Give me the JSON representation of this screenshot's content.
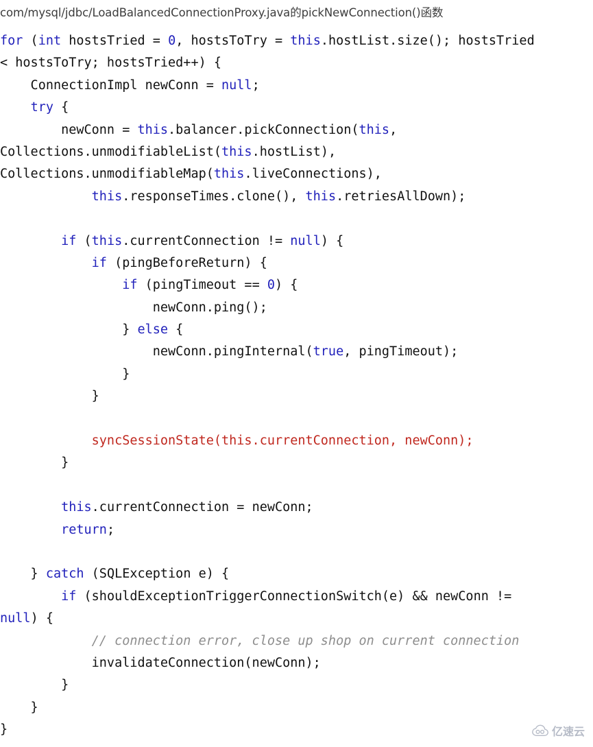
{
  "caption": {
    "text": "com/mysql/jdbc/LoadBalancedConnectionProxy.java的pickNewConnection()函数"
  },
  "colors": {
    "background": "#ffffff",
    "plain_text": "#111111",
    "keyword": "#2222bb",
    "highlight": "#c0281f",
    "comment": "#8d8d8d",
    "caption": "#3d3d3d",
    "watermark": "#8a93a5"
  },
  "code": {
    "language": "java",
    "lines": [
      {
        "n": 1,
        "segments": [
          {
            "t": "for",
            "c": "kw"
          },
          {
            "t": " (",
            "c": "pl"
          },
          {
            "t": "int",
            "c": "kw"
          },
          {
            "t": " hostsTried = ",
            "c": "pl"
          },
          {
            "t": "0",
            "c": "kw"
          },
          {
            "t": ", hostsToTry = ",
            "c": "pl"
          },
          {
            "t": "this",
            "c": "kw"
          },
          {
            "t": ".hostList.size(); hostsTried",
            "c": "pl"
          }
        ]
      },
      {
        "n": 2,
        "segments": [
          {
            "t": "< hostsToTry; hostsTried++) {",
            "c": "pl"
          }
        ]
      },
      {
        "n": 3,
        "segments": [
          {
            "t": "    ConnectionImpl newConn = ",
            "c": "pl"
          },
          {
            "t": "null",
            "c": "kw"
          },
          {
            "t": ";",
            "c": "pl"
          }
        ]
      },
      {
        "n": 4,
        "segments": [
          {
            "t": "    ",
            "c": "pl"
          },
          {
            "t": "try",
            "c": "kw"
          },
          {
            "t": " {",
            "c": "pl"
          }
        ]
      },
      {
        "n": 5,
        "segments": [
          {
            "t": "        newConn = ",
            "c": "pl"
          },
          {
            "t": "this",
            "c": "kw"
          },
          {
            "t": ".balancer.pickConnection(",
            "c": "pl"
          },
          {
            "t": "this",
            "c": "kw"
          },
          {
            "t": ",",
            "c": "pl"
          }
        ]
      },
      {
        "n": 6,
        "segments": [
          {
            "t": "Collections.unmodifiableList(",
            "c": "pl"
          },
          {
            "t": "this",
            "c": "kw"
          },
          {
            "t": ".hostList),",
            "c": "pl"
          }
        ]
      },
      {
        "n": 7,
        "segments": [
          {
            "t": "Collections.unmodifiableMap(",
            "c": "pl"
          },
          {
            "t": "this",
            "c": "kw"
          },
          {
            "t": ".liveConnections),",
            "c": "pl"
          }
        ]
      },
      {
        "n": 8,
        "segments": [
          {
            "t": "            ",
            "c": "pl"
          },
          {
            "t": "this",
            "c": "kw"
          },
          {
            "t": ".responseTimes.clone(), ",
            "c": "pl"
          },
          {
            "t": "this",
            "c": "kw"
          },
          {
            "t": ".retriesAllDown);",
            "c": "pl"
          }
        ]
      },
      {
        "n": 9,
        "segments": [
          {
            "t": "",
            "c": "pl"
          }
        ]
      },
      {
        "n": 10,
        "segments": [
          {
            "t": "        ",
            "c": "pl"
          },
          {
            "t": "if",
            "c": "kw"
          },
          {
            "t": " (",
            "c": "pl"
          },
          {
            "t": "this",
            "c": "kw"
          },
          {
            "t": ".currentConnection != ",
            "c": "pl"
          },
          {
            "t": "null",
            "c": "kw"
          },
          {
            "t": ") {",
            "c": "pl"
          }
        ]
      },
      {
        "n": 11,
        "segments": [
          {
            "t": "            ",
            "c": "pl"
          },
          {
            "t": "if",
            "c": "kw"
          },
          {
            "t": " (pingBeforeReturn) {",
            "c": "pl"
          }
        ]
      },
      {
        "n": 12,
        "segments": [
          {
            "t": "                ",
            "c": "pl"
          },
          {
            "t": "if",
            "c": "kw"
          },
          {
            "t": " (pingTimeout == ",
            "c": "pl"
          },
          {
            "t": "0",
            "c": "kw"
          },
          {
            "t": ") {",
            "c": "pl"
          }
        ]
      },
      {
        "n": 13,
        "segments": [
          {
            "t": "                    newConn.ping();",
            "c": "pl"
          }
        ]
      },
      {
        "n": 14,
        "segments": [
          {
            "t": "                } ",
            "c": "pl"
          },
          {
            "t": "else",
            "c": "kw"
          },
          {
            "t": " {",
            "c": "pl"
          }
        ]
      },
      {
        "n": 15,
        "segments": [
          {
            "t": "                    newConn.pingInternal(",
            "c": "pl"
          },
          {
            "t": "true",
            "c": "kw"
          },
          {
            "t": ", pingTimeout);",
            "c": "pl"
          }
        ]
      },
      {
        "n": 16,
        "segments": [
          {
            "t": "                }",
            "c": "pl"
          }
        ]
      },
      {
        "n": 17,
        "segments": [
          {
            "t": "            }",
            "c": "pl"
          }
        ]
      },
      {
        "n": 18,
        "segments": [
          {
            "t": "",
            "c": "pl"
          }
        ]
      },
      {
        "n": 19,
        "segments": [
          {
            "t": "            syncSessionState(this.currentConnection, newConn);",
            "c": "hl"
          }
        ]
      },
      {
        "n": 20,
        "segments": [
          {
            "t": "        }",
            "c": "pl"
          }
        ]
      },
      {
        "n": 21,
        "segments": [
          {
            "t": "",
            "c": "pl"
          }
        ]
      },
      {
        "n": 22,
        "segments": [
          {
            "t": "        ",
            "c": "pl"
          },
          {
            "t": "this",
            "c": "kw"
          },
          {
            "t": ".currentConnection = newConn;",
            "c": "pl"
          }
        ]
      },
      {
        "n": 23,
        "segments": [
          {
            "t": "        ",
            "c": "pl"
          },
          {
            "t": "return",
            "c": "kw"
          },
          {
            "t": ";",
            "c": "pl"
          }
        ]
      },
      {
        "n": 24,
        "segments": [
          {
            "t": "",
            "c": "pl"
          }
        ]
      },
      {
        "n": 25,
        "segments": [
          {
            "t": "    } ",
            "c": "pl"
          },
          {
            "t": "catch",
            "c": "kw"
          },
          {
            "t": " (SQLException e) {",
            "c": "pl"
          }
        ]
      },
      {
        "n": 26,
        "segments": [
          {
            "t": "        ",
            "c": "pl"
          },
          {
            "t": "if",
            "c": "kw"
          },
          {
            "t": " (shouldExceptionTriggerConnectionSwitch(e) && newConn !=",
            "c": "pl"
          }
        ]
      },
      {
        "n": 27,
        "segments": [
          {
            "t": "null",
            "c": "kw"
          },
          {
            "t": ") {",
            "c": "pl"
          }
        ]
      },
      {
        "n": 28,
        "segments": [
          {
            "t": "            // connection error, close up shop on current connection",
            "c": "cmt"
          }
        ]
      },
      {
        "n": 29,
        "segments": [
          {
            "t": "            invalidateConnection(newConn);",
            "c": "pl"
          }
        ]
      },
      {
        "n": 30,
        "segments": [
          {
            "t": "        }",
            "c": "pl"
          }
        ]
      },
      {
        "n": 31,
        "segments": [
          {
            "t": "    }",
            "c": "pl"
          }
        ]
      },
      {
        "n": 32,
        "segments": [
          {
            "t": "}",
            "c": "pl"
          }
        ]
      }
    ]
  },
  "watermark": {
    "icon": "cloud-icon",
    "text": "亿速云"
  }
}
